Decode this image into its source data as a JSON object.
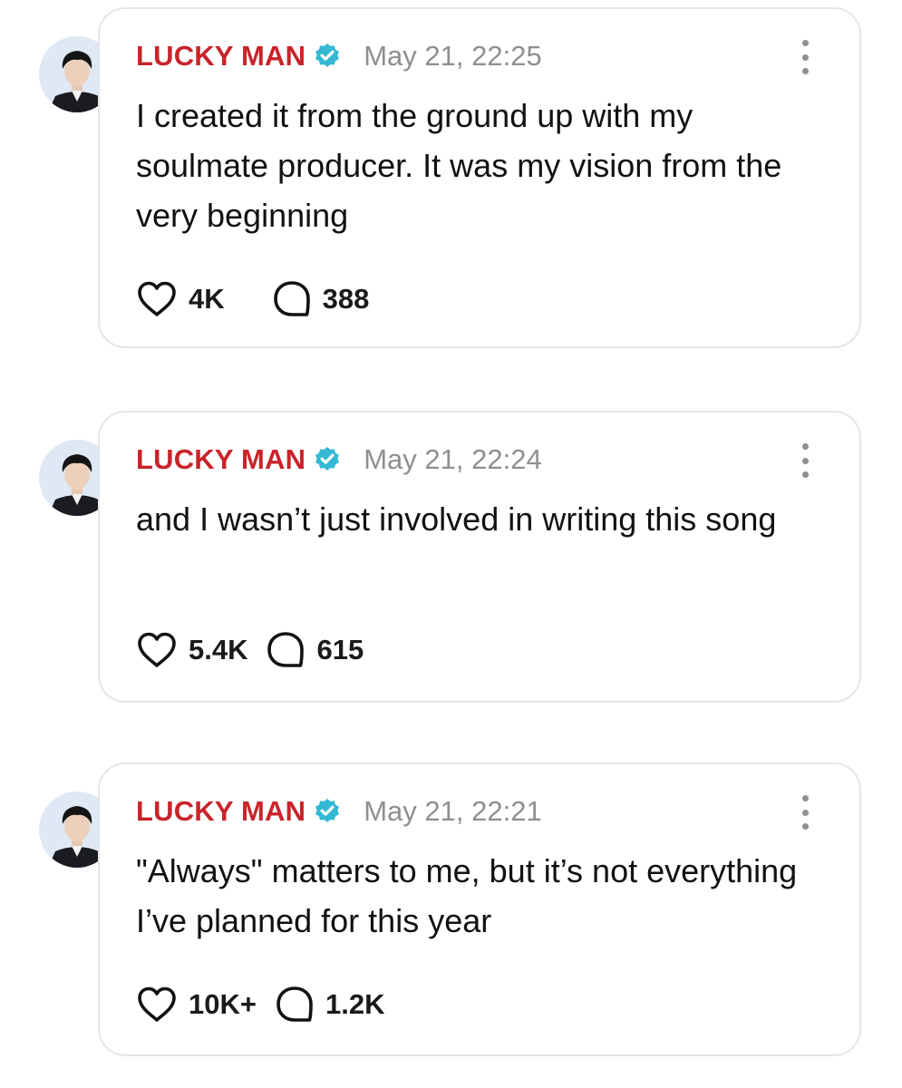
{
  "posts": [
    {
      "author": "LUCKY MAN",
      "timestamp": "May 21, 22:25",
      "text": "I created it from the ground up with my soulmate producer. It was my vision from the very beginning",
      "likes": "4K",
      "replies": "388"
    },
    {
      "author": "LUCKY MAN",
      "timestamp": "May 21, 22:24",
      "text": "and I wasn’t just involved in writing this song",
      "likes": "5.4K",
      "replies": "615"
    },
    {
      "author": "LUCKY MAN",
      "timestamp": "May 21, 22:21",
      "text": "\"Always\" matters to me, but it’s not everything I’ve planned for this year",
      "likes": "10K+",
      "replies": "1.2K"
    }
  ],
  "colors": {
    "author": "#c8242a",
    "verified_badge": "#35b8d4",
    "timestamp": "#8e8e93",
    "card_border": "#e6e6e6"
  },
  "icons": {
    "verified": "verified-badge-icon",
    "like": "heart-icon",
    "reply": "speech-bubble-icon",
    "more": "more-vertical-icon"
  }
}
